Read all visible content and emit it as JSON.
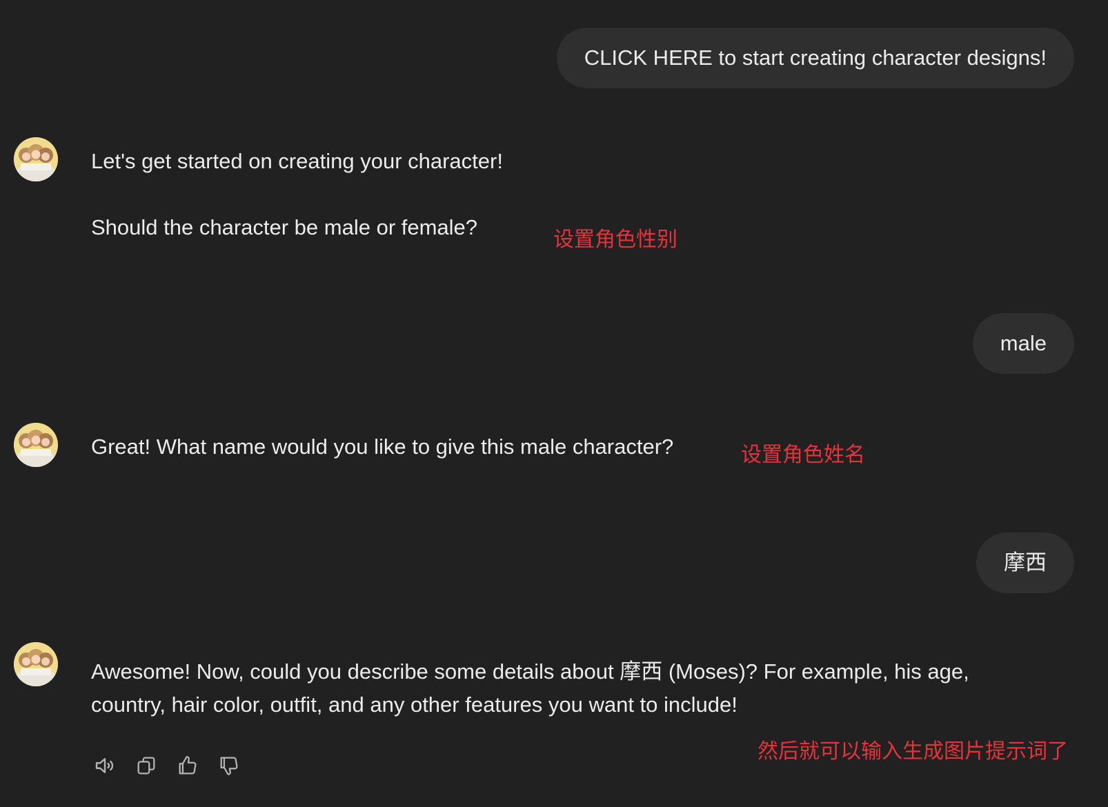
{
  "conversation": {
    "messages": [
      {
        "role": "user",
        "text": "CLICK HERE to start creating character designs!"
      },
      {
        "role": "assistant",
        "lines": [
          "Let's get started on creating your character!",
          "Should the character be male or female?"
        ]
      },
      {
        "role": "user",
        "text": "male"
      },
      {
        "role": "assistant",
        "lines": [
          "Great! What name would you like to give this male character?"
        ]
      },
      {
        "role": "user",
        "text": "摩西"
      },
      {
        "role": "assistant",
        "lines": [
          "Awesome! Now, could you describe some details about 摩西 (Moses)? For example, his age,",
          "country, hair color, outfit, and any other features you want to include!"
        ]
      }
    ]
  },
  "annotations": {
    "set_gender": "设置角色性别",
    "set_name": "设置角色姓名",
    "prompt_hint": "然后就可以输入生成图片提示词了"
  },
  "actions": [
    {
      "icon": "speaker-icon",
      "label": "Read aloud"
    },
    {
      "icon": "copy-icon",
      "label": "Copy"
    },
    {
      "icon": "thumbs-up-icon",
      "label": "Good response"
    },
    {
      "icon": "thumbs-down-icon",
      "label": "Bad response"
    }
  ],
  "colors": {
    "background": "#212121",
    "user_bubble": "#2f2f2f",
    "text": "#ececec",
    "annotation": "#e8323a",
    "icon": "#b4b4b4"
  }
}
